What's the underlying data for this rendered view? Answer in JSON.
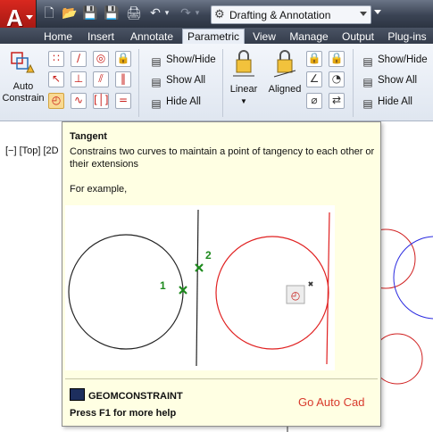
{
  "app": {
    "workspace": "Drafting & Annotation",
    "app_button_letter": "A"
  },
  "tabs": [
    {
      "label": "Home",
      "active": false
    },
    {
      "label": "Insert",
      "active": false
    },
    {
      "label": "Annotate",
      "active": false
    },
    {
      "label": "Parametric",
      "active": true
    },
    {
      "label": "View",
      "active": false
    },
    {
      "label": "Manage",
      "active": false
    },
    {
      "label": "Output",
      "active": false
    },
    {
      "label": "Plug-ins",
      "active": false
    }
  ],
  "ribbon": {
    "auto_constrain": {
      "line1": "Auto",
      "line2": "Constrain"
    },
    "geometric_visibility": {
      "show_hide": "Show/Hide",
      "show_all": "Show All",
      "hide_all": "Hide All"
    },
    "linear": "Linear",
    "aligned": "Aligned",
    "dimensional_visibility": {
      "show_hide": "Show/Hide",
      "show_all": "Show All",
      "hide_all": "Hide All"
    }
  },
  "viewport": {
    "controls": "[−] [Top] [2D"
  },
  "tooltip": {
    "title": "Tangent",
    "description": "Constrains two curves to maintain a point of tangency to each other or their extensions",
    "example_label": "For example,",
    "marker1": "1",
    "marker2": "2",
    "command": "GEOMCONSTRAINT",
    "help": "Press F1 for more help",
    "watermark": "Go Auto Cad"
  },
  "colors": {
    "accent_red": "#d83a2c",
    "tooltip_bg": "#ffffe3",
    "marker_green": "#1e8a1e"
  }
}
